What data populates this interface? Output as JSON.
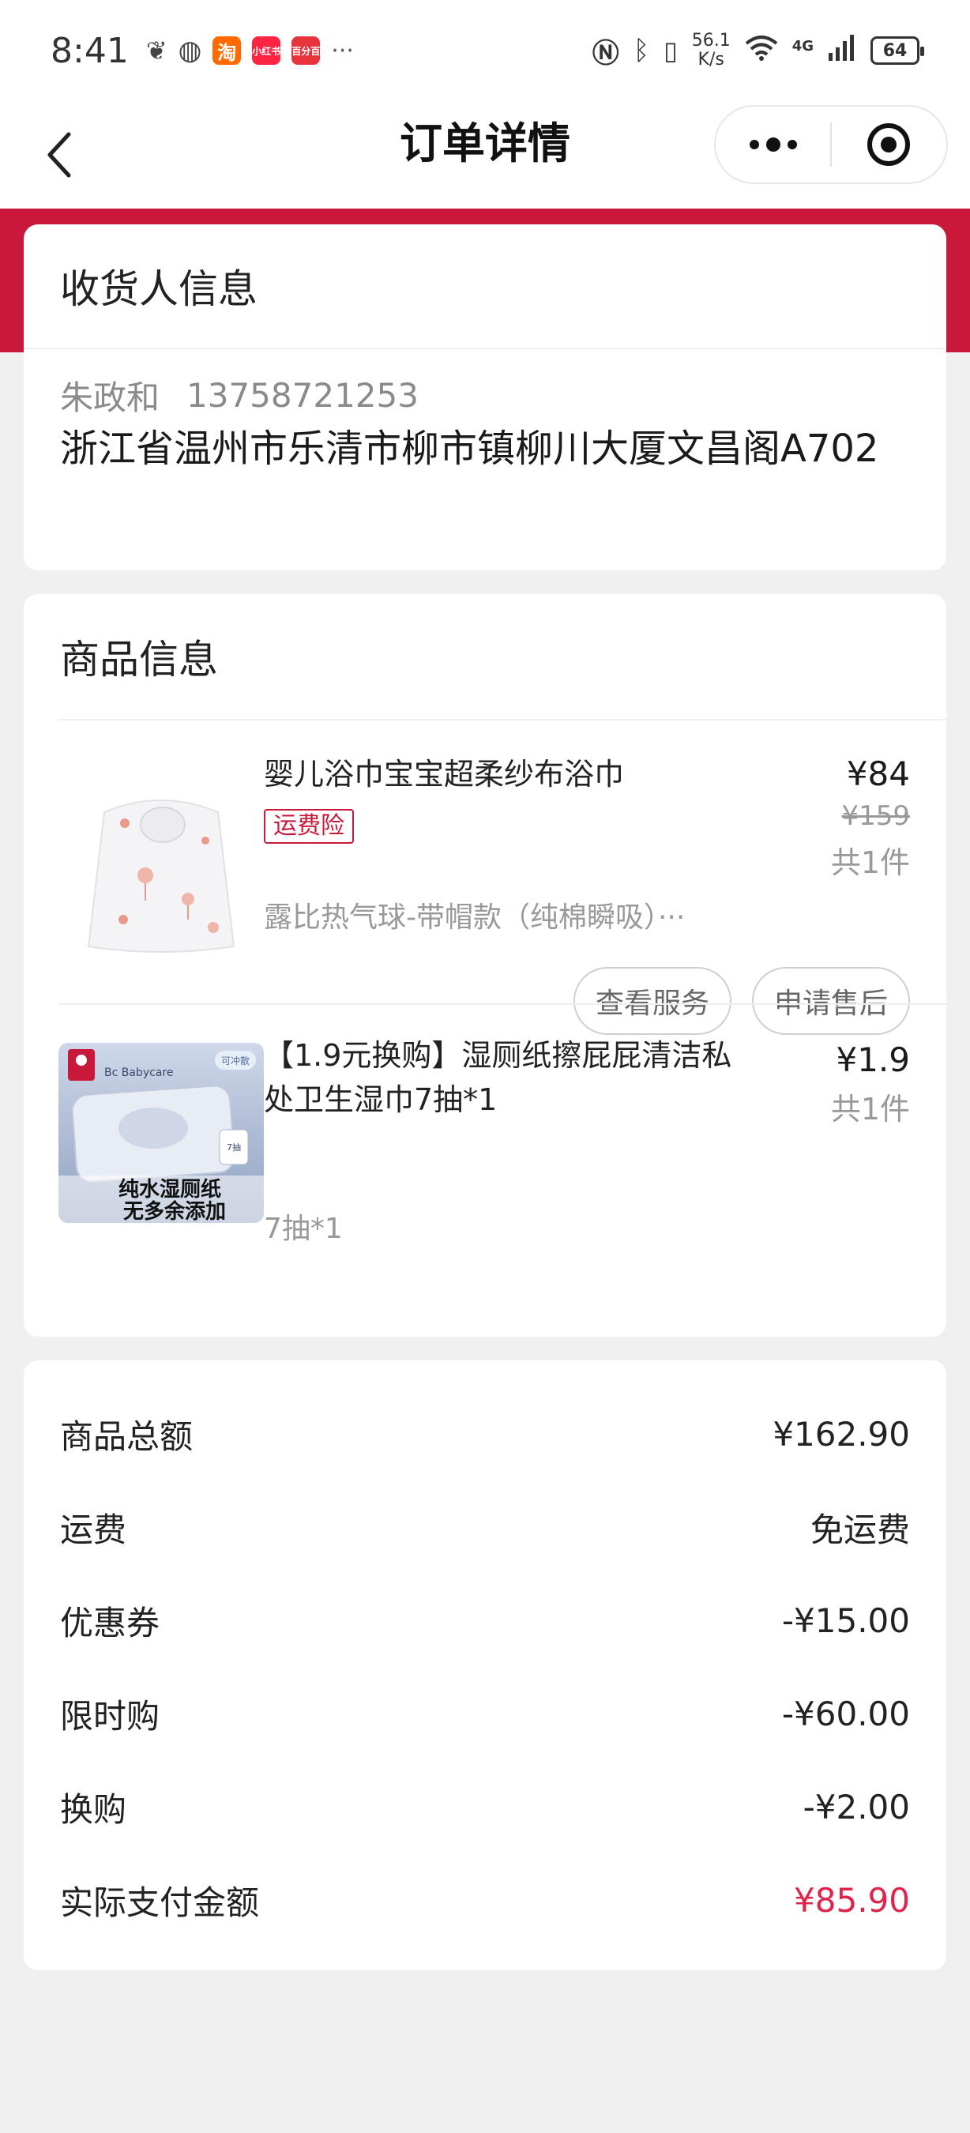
{
  "status_bar": {
    "time": "8:41",
    "apps": [
      "taobao",
      "xiaohongshu",
      "baifenbai"
    ],
    "app_labels": [
      "淘",
      "小红书",
      "百分百"
    ],
    "more": "···",
    "net_speed_value": "56.1",
    "net_speed_unit": "K/s",
    "network": "4G",
    "battery": "64"
  },
  "nav": {
    "title": "订单详情",
    "more_label": "•••"
  },
  "receiver": {
    "header": "收货人信息",
    "name": "朱政和",
    "phone": "13758721253",
    "address": "浙江省温州市乐清市柳市镇柳川大厦文昌阁A702"
  },
  "goods": {
    "header": "商品信息",
    "items": [
      {
        "name": "婴儿浴巾宝宝超柔纱布浴巾",
        "tag": "运费险",
        "spec": "露比热气球-带帽款（纯棉瞬吸）···",
        "price": "¥84",
        "original_price": "¥159",
        "quantity": "共1件",
        "actions": [
          "查看服务",
          "申请售后"
        ]
      },
      {
        "name": "【1.9元换购】湿厕纸擦屁屁清洁私处卫生湿巾7抽*1",
        "spec": "7抽*1",
        "price": "¥1.9",
        "quantity": "共1件",
        "thumb_brand": "Bc Babycare",
        "thumb_badge": "可冲散",
        "thumb_side": "7抽",
        "thumb_line1": "纯水湿厕纸",
        "thumb_line2": "无多余添加"
      }
    ]
  },
  "summary": {
    "rows": [
      {
        "label": "商品总额",
        "value": "¥162.90"
      },
      {
        "label": "运费",
        "value": "免运费"
      },
      {
        "label": "优惠券",
        "value": "-¥15.00"
      },
      {
        "label": "限时购",
        "value": "-¥60.00"
      },
      {
        "label": "换购",
        "value": "-¥2.00"
      },
      {
        "label": "实际支付金额",
        "value": "¥85.90"
      }
    ]
  },
  "colors": {
    "brand_red": "#c8193b",
    "total_red": "#e0234a",
    "background": "#f0f0f0"
  }
}
